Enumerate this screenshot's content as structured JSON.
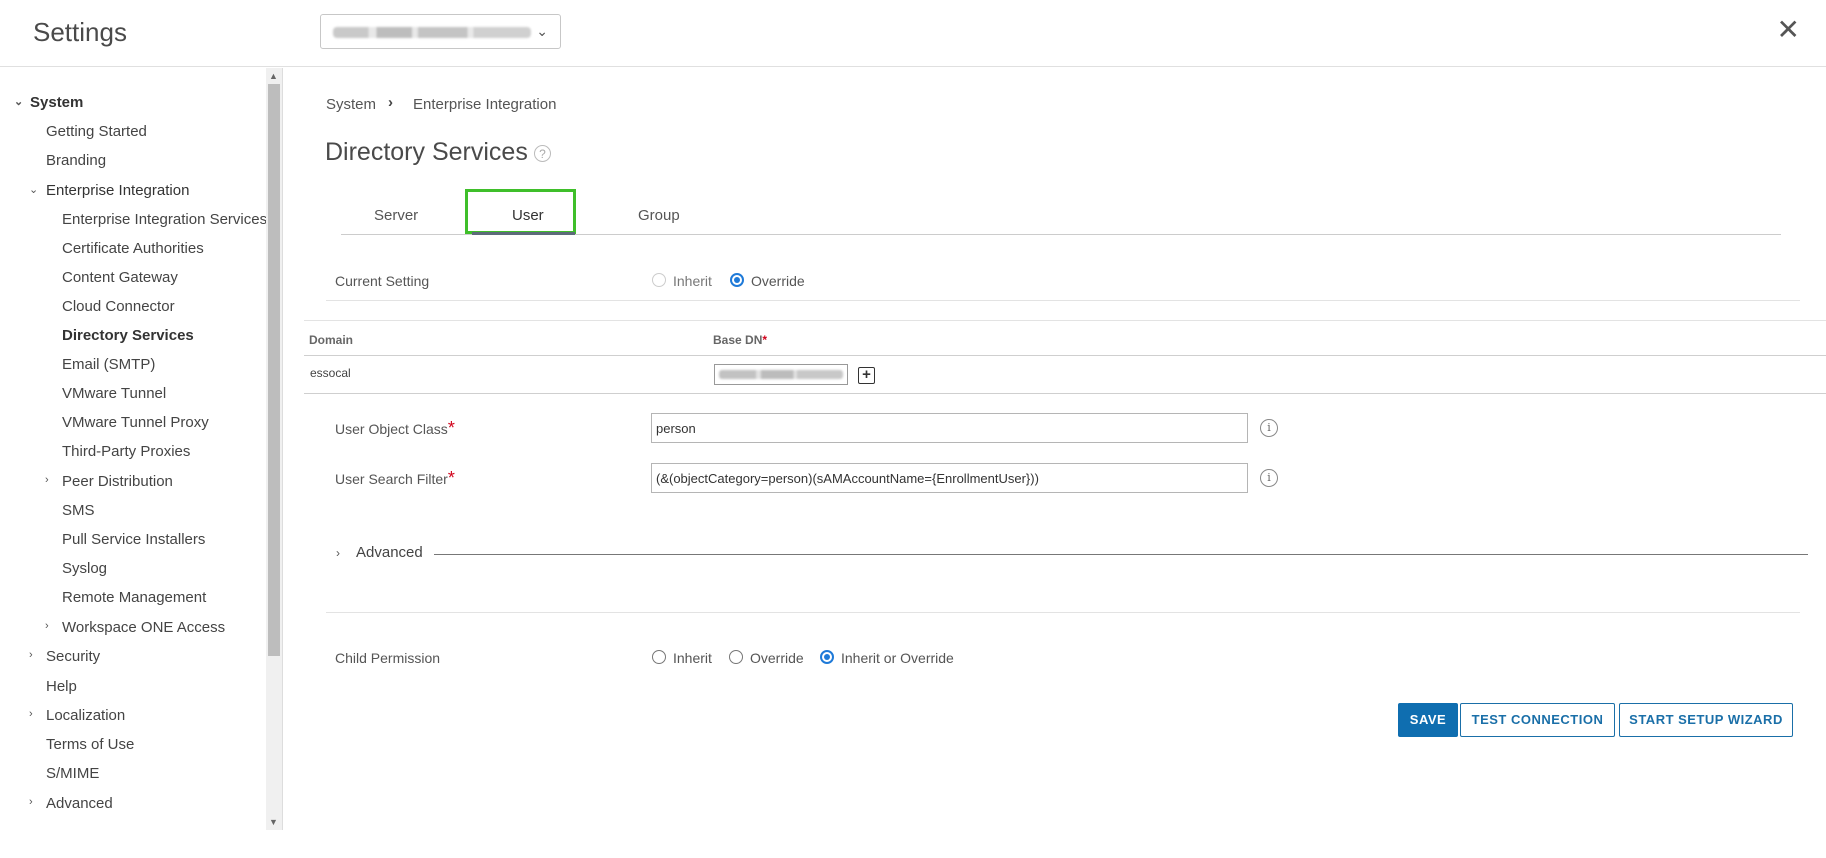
{
  "header": {
    "title": "Settings",
    "org_selector": {
      "value_blurred": true
    }
  },
  "sidebar": {
    "items": [
      {
        "label": "System",
        "level": 0,
        "expanded": true,
        "bold": true
      },
      {
        "label": "Getting Started",
        "level": 1
      },
      {
        "label": "Branding",
        "level": 1
      },
      {
        "label": "Enterprise Integration",
        "level": 1,
        "expanded": true
      },
      {
        "label": "Enterprise Integration Services",
        "level": 2
      },
      {
        "label": "Certificate Authorities",
        "level": 2
      },
      {
        "label": "Content Gateway",
        "level": 2
      },
      {
        "label": "Cloud Connector",
        "level": 2
      },
      {
        "label": "Directory Services",
        "level": 2,
        "selected": true
      },
      {
        "label": "Email (SMTP)",
        "level": 2
      },
      {
        "label": "VMware Tunnel",
        "level": 2
      },
      {
        "label": "VMware Tunnel Proxy",
        "level": 2
      },
      {
        "label": "Third-Party Proxies",
        "level": 2
      },
      {
        "label": "Peer Distribution",
        "level": 2,
        "expanded": false
      },
      {
        "label": "SMS",
        "level": 2
      },
      {
        "label": "Pull Service Installers",
        "level": 2
      },
      {
        "label": "Syslog",
        "level": 2
      },
      {
        "label": "Remote Management",
        "level": 2
      },
      {
        "label": "Workspace ONE Access",
        "level": 2,
        "expanded": false
      },
      {
        "label": "Security",
        "level": 1,
        "expanded": false
      },
      {
        "label": "Help",
        "level": 1
      },
      {
        "label": "Localization",
        "level": 1,
        "expanded": false
      },
      {
        "label": "Terms of Use",
        "level": 1
      },
      {
        "label": "S/MIME",
        "level": 1
      },
      {
        "label": "Advanced",
        "level": 1,
        "expanded": false
      }
    ]
  },
  "breadcrumb": {
    "root": "System",
    "current": "Enterprise Integration"
  },
  "page": {
    "title": "Directory Services"
  },
  "tabs": [
    {
      "label": "Server"
    },
    {
      "label": "User",
      "active": true
    },
    {
      "label": "Group"
    }
  ],
  "current_setting": {
    "label": "Current Setting",
    "options": [
      "Inherit",
      "Override"
    ],
    "selected": "Override"
  },
  "domain_table": {
    "headers": {
      "domain": "Domain",
      "base_dn": "Base DN"
    },
    "rows": [
      {
        "domain": "essocal",
        "base_dn_blurred": true
      }
    ]
  },
  "user_object_class": {
    "label": "User Object Class",
    "value": "person"
  },
  "user_search_filter": {
    "label": "User Search Filter",
    "value": "(&(objectCategory=person)(sAMAccountName={EnrollmentUser}))"
  },
  "advanced": {
    "label": "Advanced"
  },
  "child_permission": {
    "label": "Child Permission",
    "options": [
      "Inherit",
      "Override",
      "Inherit or Override"
    ],
    "selected": "Inherit or Override"
  },
  "buttons": {
    "save": "SAVE",
    "test": "TEST CONNECTION",
    "wizard": "START SETUP WIZARD"
  },
  "colors": {
    "primary": "#0f6eb0",
    "tab_highlight": "#3fbf2a",
    "required": "#d0021b",
    "radio_selected": "#1f7ad8"
  }
}
